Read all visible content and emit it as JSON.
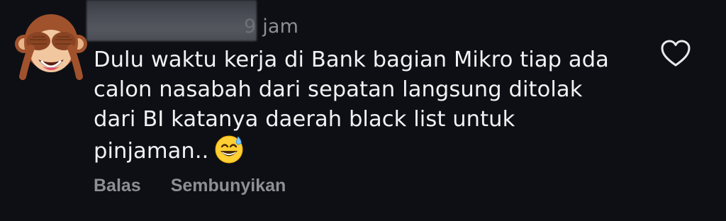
{
  "comment": {
    "timestamp_visible_digit": "9",
    "timestamp_unit": "jam",
    "text_lines": [
      "Dulu waktu kerja di Bank bagian Mikro tiap ada",
      "calon nasabah dari sepatan langsung ditolak",
      "dari BI katanya daerah black list untuk",
      "pinjaman.."
    ],
    "avatar_icon": "see-no-evil-monkey-icon",
    "trailing_emoji_icon": "grinning-sweat-emoji-icon",
    "like_icon": "heart-outline-icon"
  },
  "actions": {
    "reply_label": "Balas",
    "hide_label": "Sembunyikan"
  },
  "colors": {
    "background": "#0e0f14",
    "text": "#f2f2f4",
    "muted": "#8e8f96"
  }
}
